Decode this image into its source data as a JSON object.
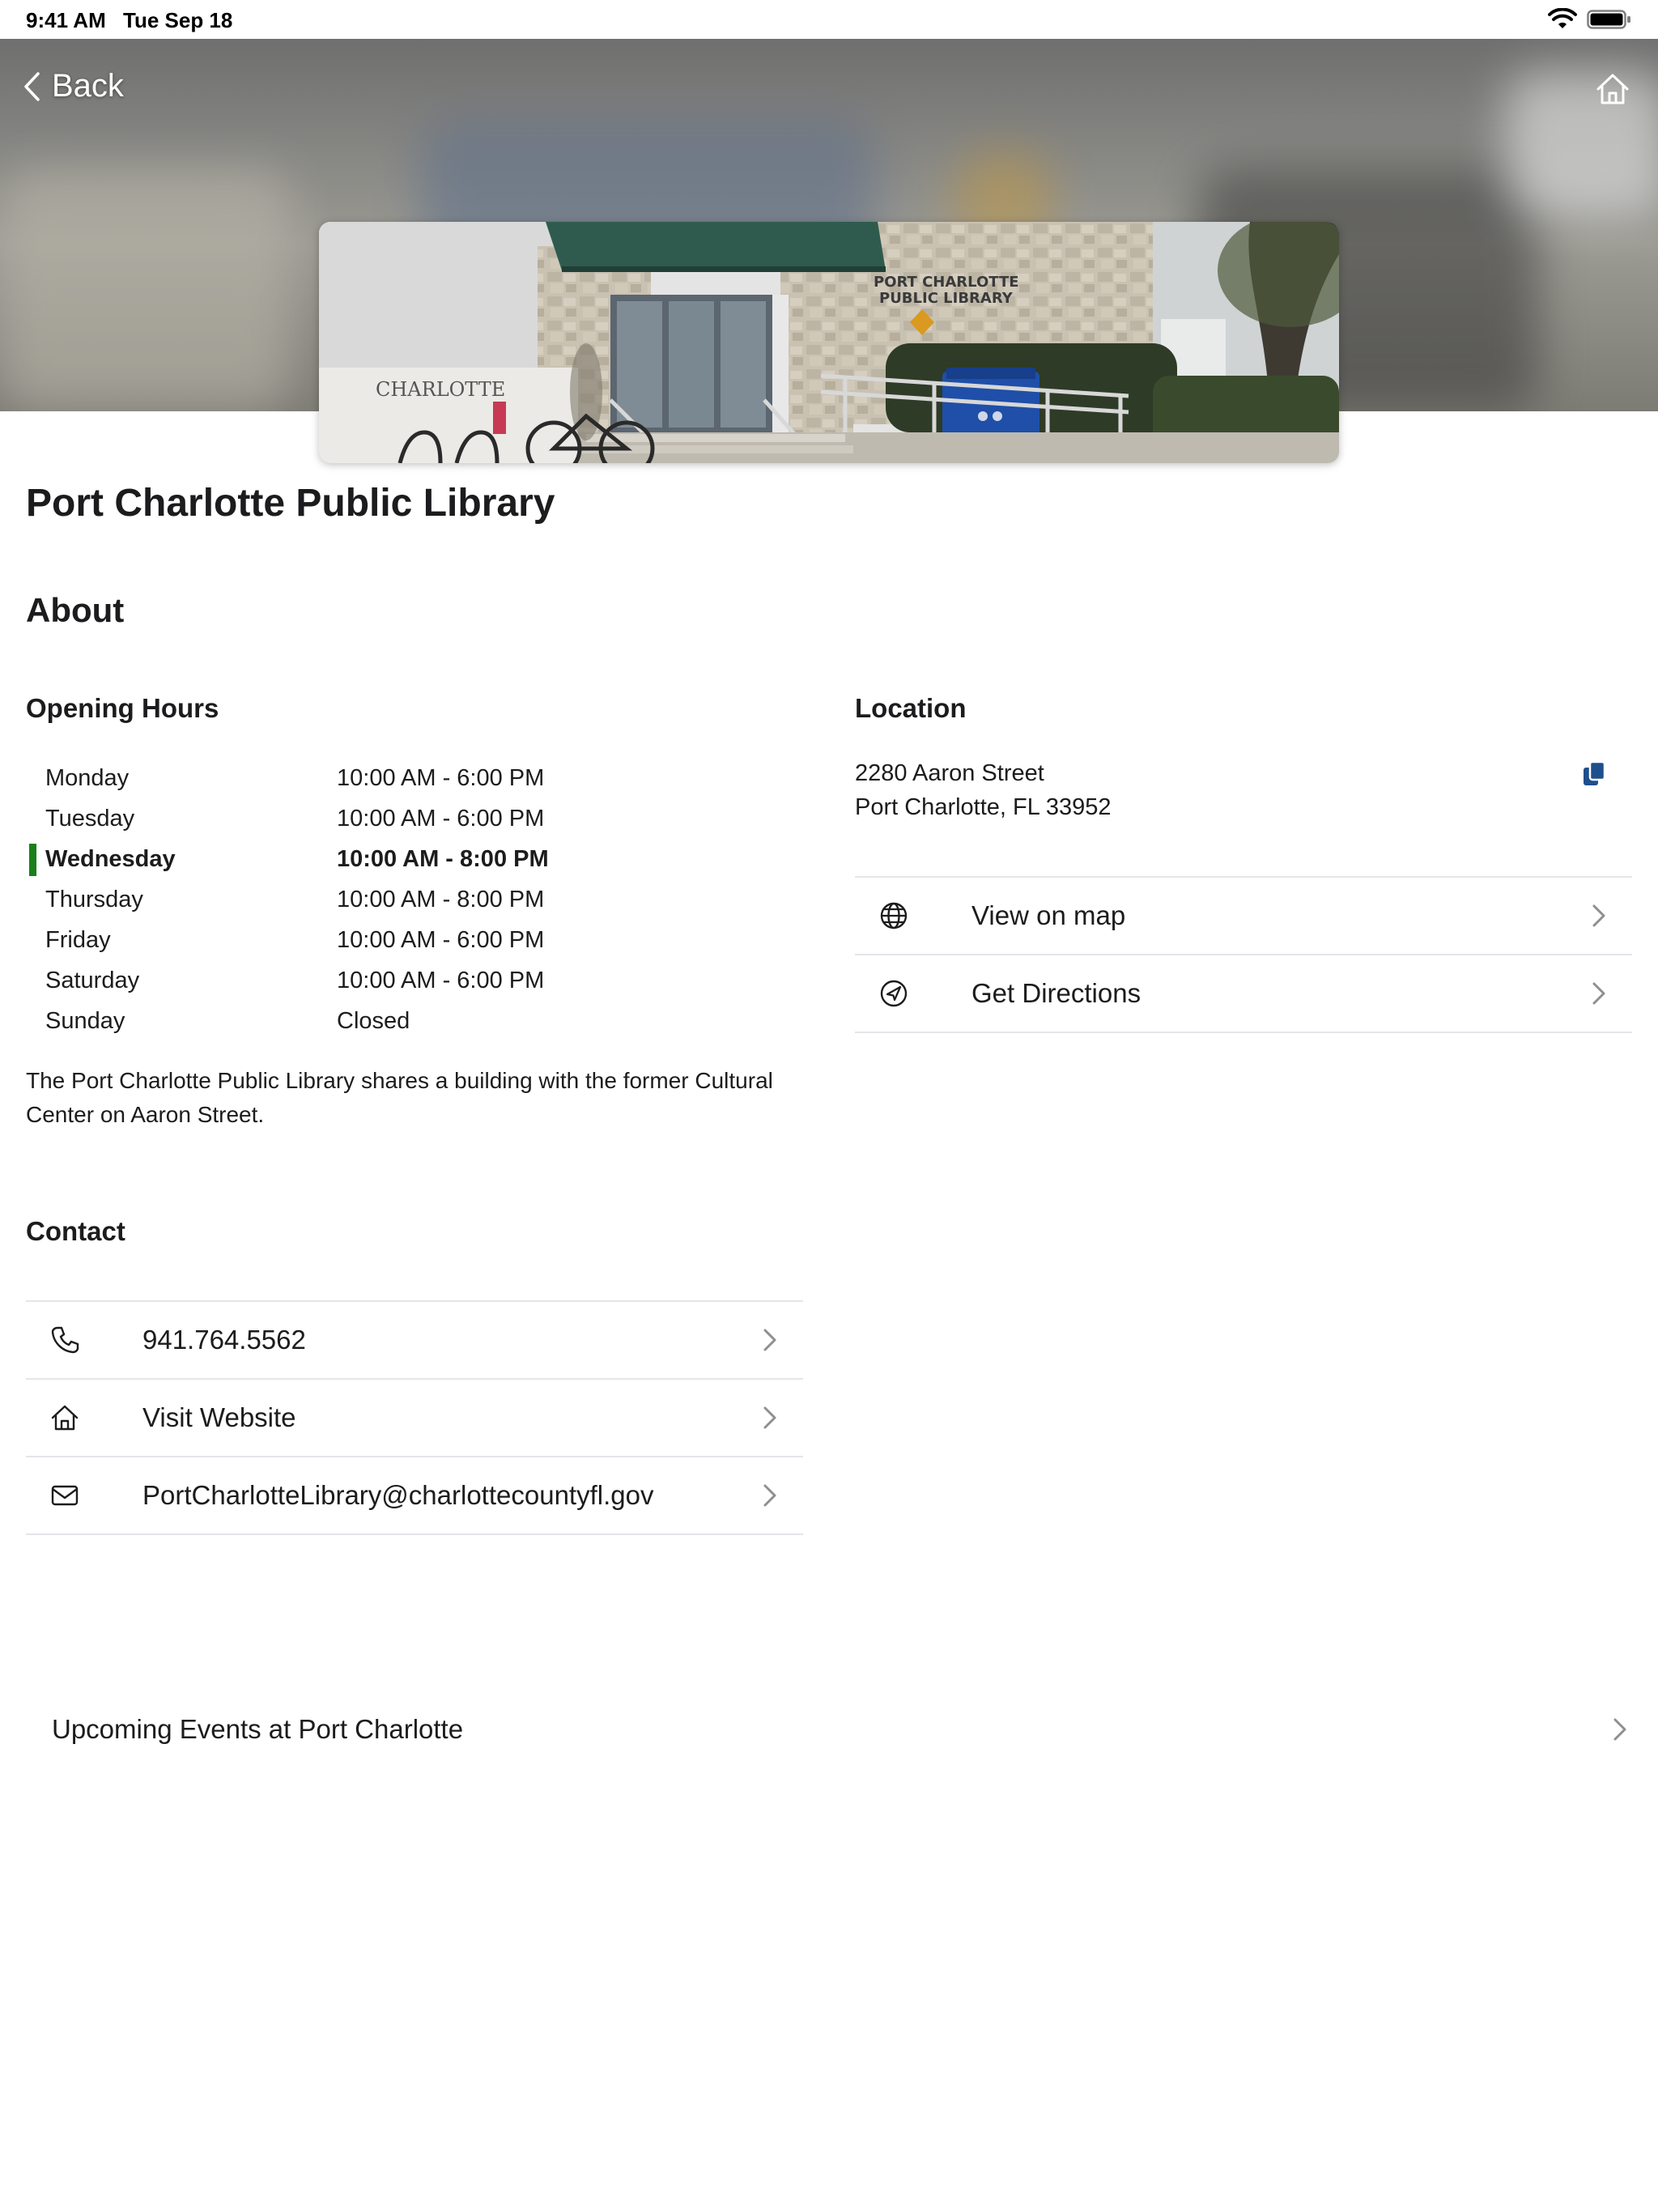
{
  "status_bar": {
    "time": "9:41 AM",
    "date": "Tue Sep 18",
    "icons": [
      "wifi-icon",
      "battery-icon"
    ]
  },
  "nav": {
    "back_label": "Back",
    "home_icon": "home-icon"
  },
  "library": {
    "name": "Port Charlotte Public Library",
    "image_signage": [
      "PORT CHARLOTTE",
      "PUBLIC LIBRARY",
      "CHARLOTTE"
    ]
  },
  "about": {
    "heading": "About",
    "description": "The Port Charlotte Public Library shares a building with the former Cultural Center on Aaron Street."
  },
  "hours": {
    "heading": "Opening Hours",
    "today_color": "#1a7f1a",
    "rows": [
      {
        "day": "Monday",
        "time": "10:00 AM - 6:00 PM",
        "today": false
      },
      {
        "day": "Tuesday",
        "time": "10:00 AM - 6:00 PM",
        "today": false
      },
      {
        "day": "Wednesday",
        "time": "10:00 AM - 8:00 PM",
        "today": true
      },
      {
        "day": "Thursday",
        "time": "10:00 AM - 8:00 PM",
        "today": false
      },
      {
        "day": "Friday",
        "time": "10:00 AM - 6:00 PM",
        "today": false
      },
      {
        "day": "Saturday",
        "time": "10:00 AM - 6:00 PM",
        "today": false
      },
      {
        "day": "Sunday",
        "time": "Closed",
        "today": false
      }
    ]
  },
  "location": {
    "heading": "Location",
    "address_line1": "2280 Aaron Street",
    "address_line2": "Port Charlotte, FL 33952",
    "copy_icon": "copy-icon",
    "accent_color": "#1f4e8c",
    "actions": [
      {
        "label": "View on map",
        "icon": "globe-icon"
      },
      {
        "label": "Get Directions",
        "icon": "directions-icon"
      }
    ]
  },
  "contact": {
    "heading": "Contact",
    "items": [
      {
        "label": "941.764.5562",
        "icon": "phone-icon"
      },
      {
        "label": "Visit Website",
        "icon": "home-icon"
      },
      {
        "label": "PortCharlotteLibrary@charlottecountyfl.gov",
        "icon": "mail-icon"
      }
    ]
  },
  "events": {
    "label": "Upcoming Events at Port Charlotte"
  }
}
